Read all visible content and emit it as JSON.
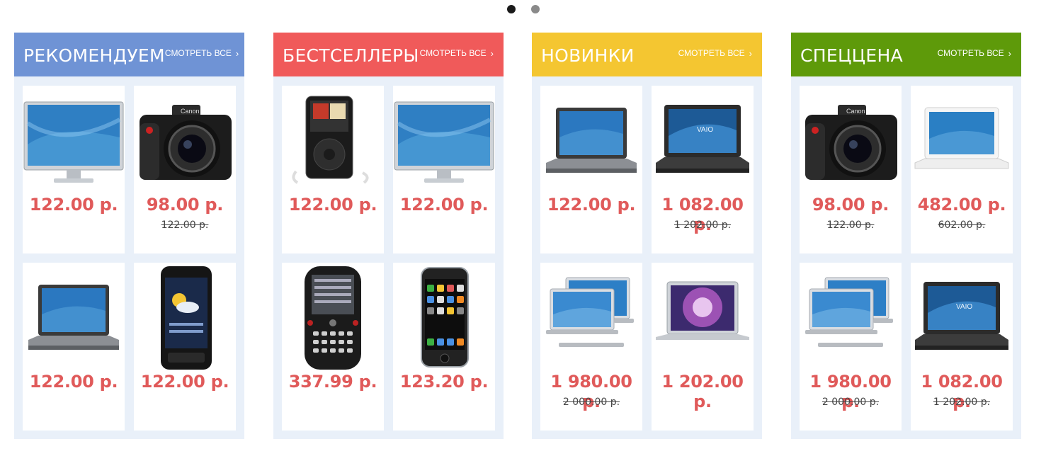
{
  "pagination": {
    "dots": 2,
    "active": 0
  },
  "columns": [
    {
      "title": "РЕКОМЕНДУЕМ",
      "see_all": "СМОТРЕТЬ ВСЕ",
      "color": "#6f93d5",
      "products": [
        {
          "image": "monitor-image",
          "price": "122.00 р.",
          "old_price": ""
        },
        {
          "image": "camera-image",
          "price": "98.00 р.",
          "old_price": "122.00 р."
        },
        {
          "image": "laptop-image",
          "price": "122.00 р.",
          "old_price": ""
        },
        {
          "image": "smartphone-image",
          "price": "122.00 р.",
          "old_price": ""
        }
      ]
    },
    {
      "title": "БЕСТСЕЛЛЕРЫ",
      "see_all": "СМОТРЕТЬ ВСЕ",
      "color": "#f05a5a",
      "products": [
        {
          "image": "ipod-image",
          "price": "122.00 р.",
          "old_price": ""
        },
        {
          "image": "monitor-image",
          "price": "122.00 р.",
          "old_price": ""
        },
        {
          "image": "qwerty-phone-image",
          "price": "337.99 р.",
          "old_price": ""
        },
        {
          "image": "iphone-image",
          "price": "123.20 р.",
          "old_price": ""
        }
      ]
    },
    {
      "title": "НОВИНКИ",
      "see_all": "СМОТРЕТЬ ВСЕ",
      "color": "#f4c631",
      "products": [
        {
          "image": "laptop-image",
          "price": "122.00 р.",
          "old_price": ""
        },
        {
          "image": "vaio-laptop-image",
          "price": "1 082.00 р.",
          "old_price": "1 202.00 р."
        },
        {
          "image": "macbook-pair-image",
          "price": "1 980.00 р.",
          "old_price": "2 000.00 р."
        },
        {
          "image": "macbook-air-image",
          "price": "1 202.00 р.",
          "old_price": ""
        }
      ]
    },
    {
      "title": "СПЕЦЦЕНА",
      "see_all": "СМОТРЕТЬ ВСЕ",
      "color": "#5e9a0a",
      "products": [
        {
          "image": "camera-image",
          "price": "98.00 р.",
          "old_price": "122.00 р."
        },
        {
          "image": "white-macbook-image",
          "price": "482.00 р.",
          "old_price": "602.00 р."
        },
        {
          "image": "macbook-pair-image",
          "price": "1 980.00 р.",
          "old_price": "2 000.00 р."
        },
        {
          "image": "vaio-laptop-image",
          "price": "1 082.00 р.",
          "old_price": "1 202.00 р."
        }
      ]
    }
  ]
}
